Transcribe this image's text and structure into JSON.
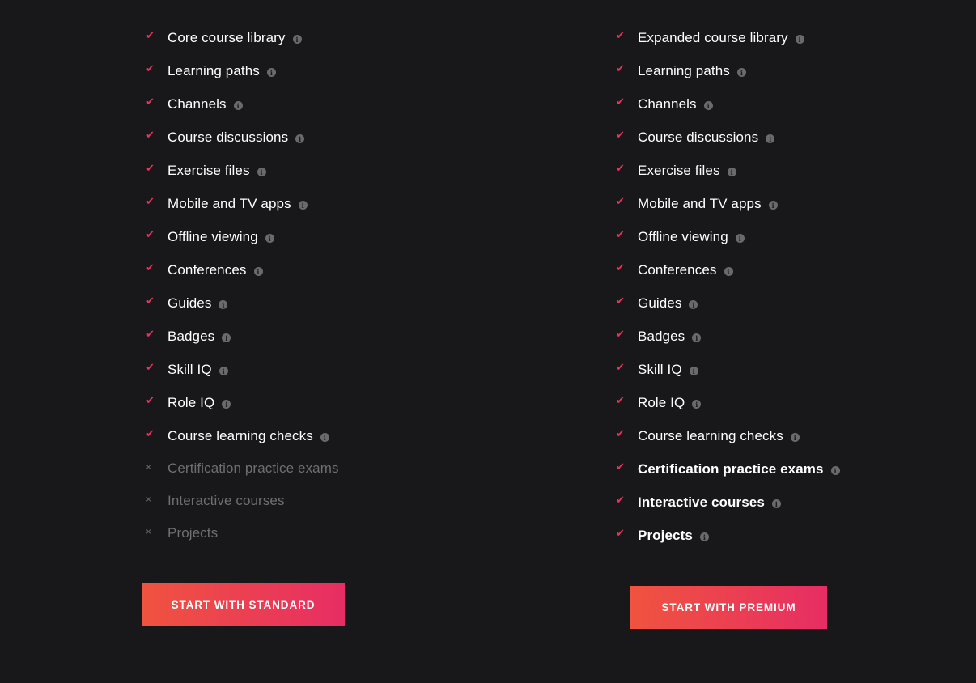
{
  "colors": {
    "background": "#181719",
    "check": "#e7335c",
    "excluded_text": "#6f6e72",
    "button_gradient_start": "#f0533f",
    "button_gradient_end": "#e72d64"
  },
  "icons": {
    "included": "✔",
    "excluded": "×",
    "info": "i"
  },
  "standard": {
    "features": [
      {
        "label": "Core course library"
      },
      {
        "label": "Learning paths"
      },
      {
        "label": "Channels"
      },
      {
        "label": "Course discussions"
      },
      {
        "label": "Exercise files"
      },
      {
        "label": "Mobile and TV apps"
      },
      {
        "label": "Offline viewing"
      },
      {
        "label": "Conferences"
      },
      {
        "label": "Guides"
      },
      {
        "label": "Badges"
      },
      {
        "label": "Skill IQ"
      },
      {
        "label": "Role IQ"
      },
      {
        "label": "Course learning checks"
      },
      {
        "label": "Certification practice exams"
      },
      {
        "label": "Interactive courses"
      },
      {
        "label": "Projects"
      }
    ],
    "button_label": "START WITH STANDARD"
  },
  "premium": {
    "features": [
      {
        "label": "Expanded course library"
      },
      {
        "label": "Learning paths"
      },
      {
        "label": "Channels"
      },
      {
        "label": "Course discussions"
      },
      {
        "label": "Exercise files"
      },
      {
        "label": "Mobile and TV apps"
      },
      {
        "label": "Offline viewing"
      },
      {
        "label": "Conferences"
      },
      {
        "label": "Guides"
      },
      {
        "label": "Badges"
      },
      {
        "label": "Skill IQ"
      },
      {
        "label": "Role IQ"
      },
      {
        "label": "Course learning checks"
      },
      {
        "label": "Certification practice exams"
      },
      {
        "label": "Interactive courses"
      },
      {
        "label": "Projects"
      }
    ],
    "button_label": "START WITH PREMIUM"
  }
}
